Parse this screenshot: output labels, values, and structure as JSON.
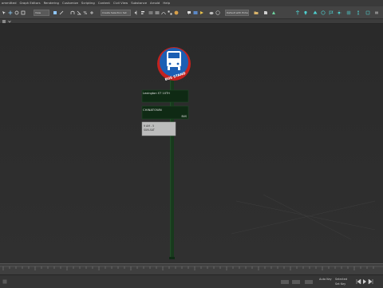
{
  "menu": [
    "ommitted",
    "Graph Editors",
    "Rendering",
    "Customize",
    "Scripting",
    "Content",
    "Civil View",
    "Substance",
    "Arnold",
    "Help"
  ],
  "toolbar": {
    "view_dropdown": "View",
    "selection_set_dropdown": "Create Selection Set",
    "workspace_dropdown": "Default with Enhanced"
  },
  "sign": {
    "badge_text": "BUS STAND",
    "street_sign_1": "Lexington ST 10TH",
    "street_sign_2_left": "CHINATOWN",
    "street_sign_2_right": "BUS",
    "schedule_line_1": "9 AM - 5",
    "schedule_line_2": "SUN-SAT"
  },
  "colors": {
    "badge_blue": "#1c5fb4",
    "badge_red": "#c4221f",
    "sign_green": "#0f2a14",
    "pole_green": "#173a1c"
  },
  "status": {
    "auto_key": "Auto Key",
    "set_key": "Set Key",
    "selected": "Selected"
  }
}
